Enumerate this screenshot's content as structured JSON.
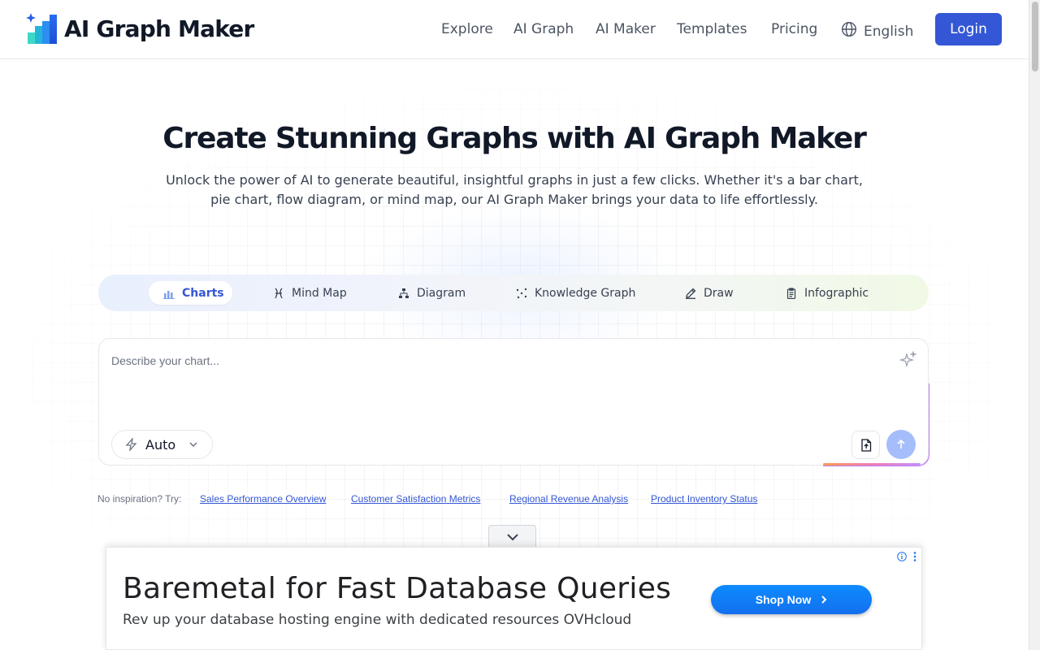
{
  "brand": {
    "name": "AI Graph Maker",
    "logo_icon": "bar-chart-sparkle-logo"
  },
  "nav": {
    "links": [
      "Explore",
      "AI Graph",
      "AI Maker",
      "Templates",
      "Pricing"
    ],
    "language": "English",
    "login": "Login"
  },
  "hero": {
    "title": "Create Stunning Graphs with AI Graph Maker",
    "subtitle": "Unlock the power of AI to generate beautiful, insightful graphs in just a few clicks. Whether it's a bar chart, pie chart, flow diagram, or mind map, our AI Graph Maker brings your data to life effortlessly."
  },
  "tabs": [
    {
      "label": "Charts",
      "icon": "bar-chart-icon",
      "active": true
    },
    {
      "label": "Mind Map",
      "icon": "mind-map-icon"
    },
    {
      "label": "Diagram",
      "icon": "diagram-icon"
    },
    {
      "label": "Knowledge Graph",
      "icon": "knowledge-graph-icon"
    },
    {
      "label": "Draw",
      "icon": "pencil-icon"
    },
    {
      "label": "Infographic",
      "icon": "clipboard-icon"
    }
  ],
  "composer": {
    "placeholder": "Describe your chart...",
    "mode": "Auto"
  },
  "suggestions": {
    "label": "No inspiration? Try:",
    "items": [
      "Sales Performance Overview",
      "Customer Satisfaction Metrics",
      "Regional Revenue Analysis",
      "Product Inventory Status"
    ]
  },
  "ad": {
    "title": "Baremetal for Fast Database Queries",
    "description": "Rev up your database hosting engine with dedicated resources OVHcloud",
    "cta": "Shop Now"
  },
  "colors": {
    "accent": "#3457d5",
    "send_button": "#a5bdfb",
    "ad_button": "#1a73e8"
  }
}
